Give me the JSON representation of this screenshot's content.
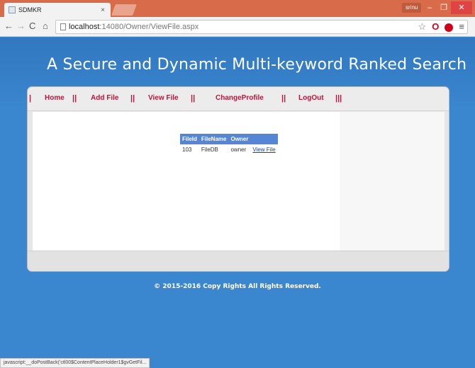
{
  "browser": {
    "tab_title": "SDMKR",
    "tab_close": "×",
    "user": "srinu",
    "min": "–",
    "max": "❐",
    "close": "✕",
    "url_host": "localhost",
    "url_path": ":14080/Owner/ViewFile.aspx",
    "back": "←",
    "forward": "→",
    "reload": "C",
    "home": "⌂",
    "star": "☆",
    "opera": "O",
    "menu": "≡"
  },
  "site": {
    "title": "A Secure and Dynamic Multi-keyword Ranked Search"
  },
  "nav": {
    "sep": "||",
    "sep_end": "|||",
    "items": [
      {
        "label": "Home"
      },
      {
        "label": "Add File"
      },
      {
        "label": "View File"
      },
      {
        "label": "ChangeProfile"
      },
      {
        "label": "LogOut"
      }
    ]
  },
  "grid": {
    "headers": [
      "FileId",
      "FileName",
      "Owner"
    ],
    "rows": [
      {
        "file_id": "103",
        "file_name": "FileDB",
        "owner": "owner",
        "action": "View File"
      }
    ]
  },
  "footer": {
    "copyright": "© 2015-2016 Copy Rights All Rights Reserved."
  },
  "status": {
    "text": "javascript:__doPostBack('ctl00$ContentPlaceHolder1$gvGetFil..."
  }
}
